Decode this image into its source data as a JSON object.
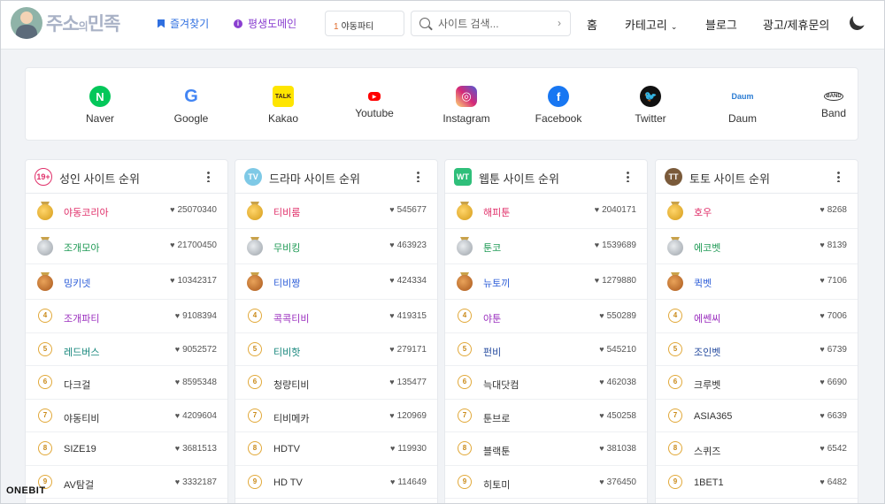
{
  "header": {
    "logo_main": "주소",
    "logo_small": "의",
    "logo_end": "민족",
    "favorites_label": "즐겨찾기",
    "domain_label": "평생도메인",
    "rank_num": "1",
    "rank_label": "야동파티",
    "search_placeholder": "사이트 검색...",
    "nav_home": "홈",
    "nav_category": "카테고리",
    "nav_blog": "블로그",
    "nav_ad": "광고/제휴문의"
  },
  "social": [
    {
      "label": "Naver",
      "color": "#03c75a",
      "glyph": "N"
    },
    {
      "label": "Google",
      "color": "#4285f4",
      "glyph": "G"
    },
    {
      "label": "Kakao",
      "color": "#fee500",
      "glyph": "TALK"
    },
    {
      "label": "Youtube",
      "color": "#ff0000",
      "glyph": "▶"
    },
    {
      "label": "Instagram",
      "color": "#d6249f",
      "glyph": "◎"
    },
    {
      "label": "Facebook",
      "color": "#1877f2",
      "glyph": "f"
    },
    {
      "label": "Twitter",
      "color": "#111111",
      "glyph": "🐦"
    },
    {
      "label": "Daum",
      "color": "#ffffff",
      "glyph": "Daum"
    },
    {
      "label": "Band",
      "color": "#ffffff",
      "glyph": "BAND"
    }
  ],
  "columns": [
    {
      "title": "성인 사이트 순위",
      "icon_text": "19+",
      "rows": [
        {
          "rank": "1",
          "name": "야동코리아",
          "count": "25070340",
          "color": "c-red"
        },
        {
          "rank": "2",
          "name": "조개모아",
          "count": "21700450",
          "color": "c-green"
        },
        {
          "rank": "3",
          "name": "밍키넷",
          "count": "10342317",
          "color": "c-blue"
        },
        {
          "rank": "4",
          "name": "조개파티",
          "count": "9108394",
          "color": "c-purple"
        },
        {
          "rank": "5",
          "name": "레드버스",
          "count": "9052572",
          "color": "c-teal"
        },
        {
          "rank": "6",
          "name": "다크걸",
          "count": "8595348",
          "color": ""
        },
        {
          "rank": "7",
          "name": "야동티비",
          "count": "4209604",
          "color": ""
        },
        {
          "rank": "8",
          "name": "SIZE19",
          "count": "3681513",
          "color": ""
        },
        {
          "rank": "9",
          "name": "AV탐걸",
          "count": "3332187",
          "color": ""
        }
      ]
    },
    {
      "title": "드라마 사이트 순위",
      "icon_text": "TV",
      "rows": [
        {
          "rank": "1",
          "name": "티비룸",
          "count": "545677",
          "color": "c-red"
        },
        {
          "rank": "2",
          "name": "무비킹",
          "count": "463923",
          "color": "c-green"
        },
        {
          "rank": "3",
          "name": "티비짱",
          "count": "424334",
          "color": "c-blue"
        },
        {
          "rank": "4",
          "name": "콕콕티비",
          "count": "419315",
          "color": "c-purple"
        },
        {
          "rank": "5",
          "name": "티비핫",
          "count": "279171",
          "color": "c-teal"
        },
        {
          "rank": "6",
          "name": "청량티비",
          "count": "135477",
          "color": ""
        },
        {
          "rank": "7",
          "name": "티비메카",
          "count": "120969",
          "color": ""
        },
        {
          "rank": "8",
          "name": "HDTV",
          "count": "119930",
          "color": ""
        },
        {
          "rank": "9",
          "name": "HD TV",
          "count": "114649",
          "color": ""
        }
      ]
    },
    {
      "title": "웹툰 사이트 순위",
      "icon_text": "WT",
      "rows": [
        {
          "rank": "1",
          "name": "해피툰",
          "count": "2040171",
          "color": "c-red"
        },
        {
          "rank": "2",
          "name": "툰코",
          "count": "1539689",
          "color": "c-green"
        },
        {
          "rank": "3",
          "name": "뉴토끼",
          "count": "1279880",
          "color": "c-blue"
        },
        {
          "rank": "4",
          "name": "야툰",
          "count": "550289",
          "color": "c-purple"
        },
        {
          "rank": "5",
          "name": "펀비",
          "count": "545210",
          "color": "c-navy"
        },
        {
          "rank": "6",
          "name": "늑대닷컴",
          "count": "462038",
          "color": ""
        },
        {
          "rank": "7",
          "name": "툰브로",
          "count": "450258",
          "color": ""
        },
        {
          "rank": "8",
          "name": "블랙툰",
          "count": "381038",
          "color": ""
        },
        {
          "rank": "9",
          "name": "히토미",
          "count": "376450",
          "color": ""
        }
      ]
    },
    {
      "title": "토토 사이트 순위",
      "icon_text": "TT",
      "rows": [
        {
          "rank": "1",
          "name": "호우",
          "count": "8268",
          "color": "c-red"
        },
        {
          "rank": "2",
          "name": "에코벳",
          "count": "8139",
          "color": "c-green"
        },
        {
          "rank": "3",
          "name": "퀵벳",
          "count": "7106",
          "color": "c-blue"
        },
        {
          "rank": "4",
          "name": "에쎈씨",
          "count": "7006",
          "color": "c-purple"
        },
        {
          "rank": "5",
          "name": "조인벳",
          "count": "6739",
          "color": "c-navy"
        },
        {
          "rank": "6",
          "name": "크루벳",
          "count": "6690",
          "color": ""
        },
        {
          "rank": "7",
          "name": "ASIA365",
          "count": "6639",
          "color": ""
        },
        {
          "rank": "8",
          "name": "스퀴즈",
          "count": "6542",
          "color": ""
        },
        {
          "rank": "9",
          "name": "1BET1",
          "count": "6482",
          "color": ""
        }
      ]
    }
  ],
  "watermark": "ONEBIT"
}
